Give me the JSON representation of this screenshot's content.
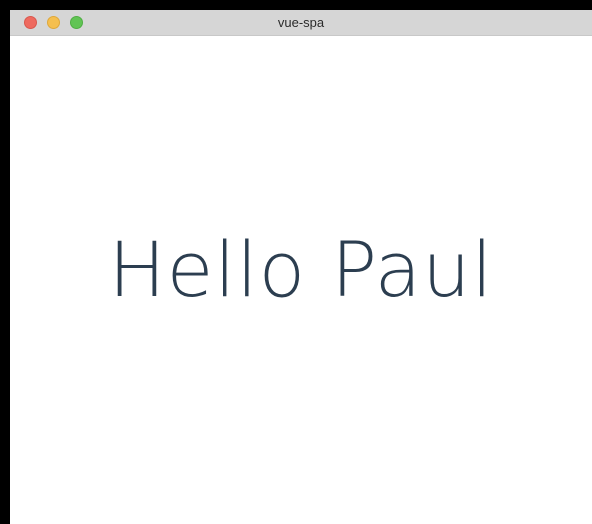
{
  "window": {
    "title": "vue-spa"
  },
  "colors": {
    "titlebar": "#d6d6d6",
    "close": "#ee6a5f",
    "minimize": "#f5bf4f",
    "zoom": "#61c454",
    "text": "#2c3e50"
  },
  "main": {
    "greeting": "Hello Paul"
  }
}
